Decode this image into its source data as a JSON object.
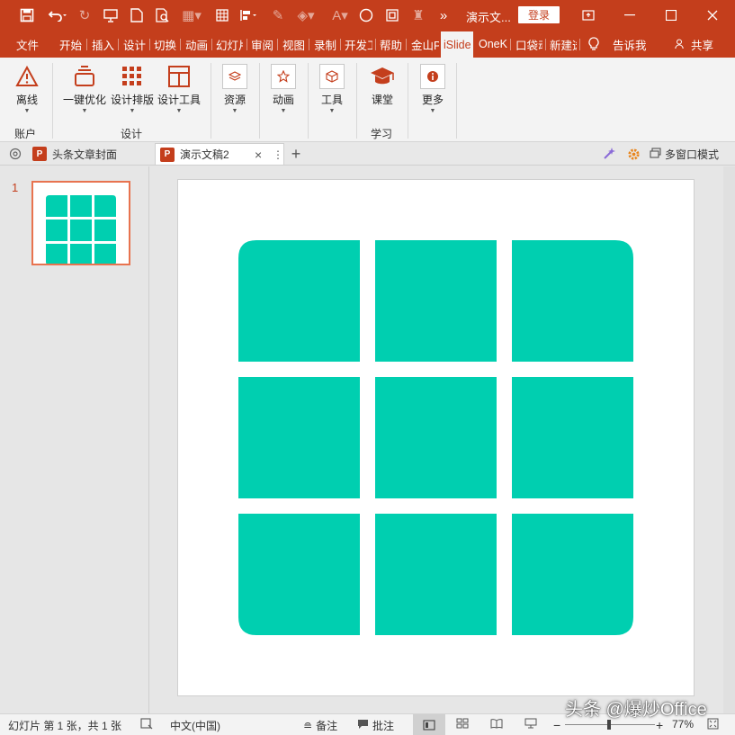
{
  "app": {
    "doc_title": "演示文...",
    "login_label": "登录"
  },
  "tabs": [
    "文件",
    "开始",
    "插入",
    "设计",
    "切换",
    "动画",
    "幻灯片",
    "审阅",
    "视图",
    "录制",
    "开发工",
    "帮助",
    "金山PD",
    "iSlide",
    "OneKe",
    "口袋动",
    "新建选"
  ],
  "active_tab": "iSlide",
  "tell_me": "告诉我",
  "share": "共享",
  "ribbon": {
    "offline": "离线",
    "account_group": "账户",
    "one_key_optimize": "一键优化",
    "design_layout": "设计排版",
    "design_tools": "设计工具",
    "design_group": "设计",
    "resources": "资源",
    "animation": "动画",
    "tools": "工具",
    "classroom": "课堂",
    "learn_group": "学习",
    "more": "更多"
  },
  "doc_tabs": {
    "tab1": "头条文章封面",
    "tab2": "演示文稿2",
    "multi_window": "多窗口模式"
  },
  "slides": {
    "number": "1"
  },
  "grid": {
    "rows": 3,
    "cols": 3,
    "color": "#00cfb0"
  },
  "status": {
    "slide_info": "幻灯片 第 1 张，共 1 张",
    "language": "中文(中国)",
    "notes": "备注",
    "comments": "批注",
    "zoom": "77%",
    "zoom_fraction": 0.77
  },
  "watermark": "头条 @爆炒Office",
  "colors": {
    "accent": "#c43e1c",
    "thumb_border": "#e8734f"
  }
}
